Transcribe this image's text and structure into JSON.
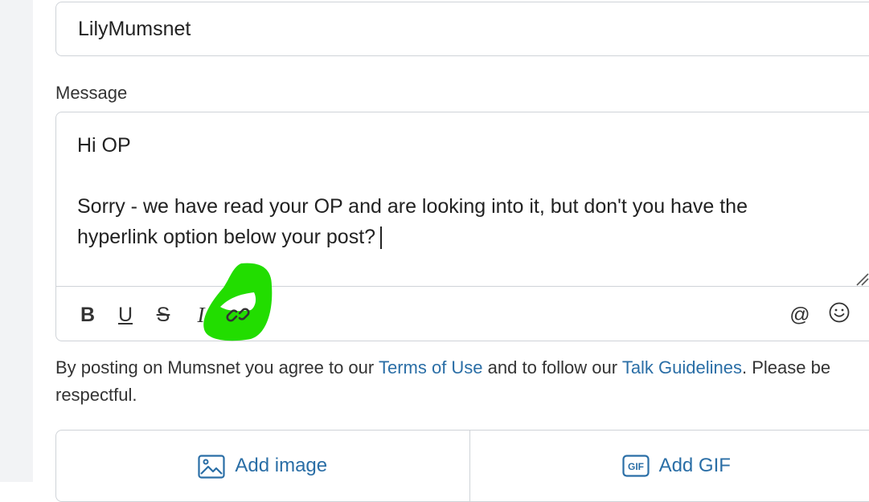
{
  "form": {
    "username_value": "LilyMumsnet",
    "message_label": "Message",
    "message_lines": [
      "Hi OP",
      "",
      "Sorry - we have read your OP and are looking into it, but don't you have the",
      "hyperlink option below your post?"
    ]
  },
  "toolbar": {
    "bold_label": "B",
    "underline_label": "U",
    "strike_label": "S",
    "italic_label": "I",
    "mention_label": "@",
    "emoji_label": "☺",
    "icons": [
      "link-icon"
    ]
  },
  "terms": {
    "prefix": "By posting on Mumsnet you agree to our ",
    "terms_link": "Terms of Use",
    "middle": " and to follow our ",
    "guidelines_link": "Talk Guidelines",
    "suffix": ". Please be respectful."
  },
  "media": {
    "add_image_label": "Add image",
    "add_gif_label": "Add GIF",
    "gif_icon_text": "GIF"
  },
  "colors": {
    "link": "#2a6ea6",
    "border": "#cfd3d8",
    "highlight": "#22dd00"
  }
}
